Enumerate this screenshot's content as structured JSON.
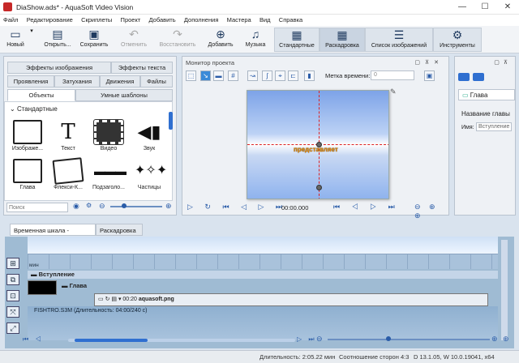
{
  "window": {
    "title": "DiaShow.ads* - AquaSoft Video Vision",
    "minimize": "—",
    "maximize": "☐",
    "close": "✕"
  },
  "menu": [
    "Файл",
    "Редактирование",
    "Скриплеты",
    "Проект",
    "Добавить",
    "Дополнения",
    "Мастера",
    "Вид",
    "Справка"
  ],
  "toolbar": {
    "new": "Новый",
    "open": "Открыть...",
    "save": "Сохранить",
    "undo": "Отменить",
    "redo": "Восстановить",
    "add": "Добавить",
    "music": "Музыка",
    "standard": "Стандартные",
    "storyboard": "Раскадровка",
    "image_list": "Список изображений",
    "tools": "Инструменты"
  },
  "left_panel": {
    "tabs_row1": [
      "Эффекты изображения",
      "Эффекты текста"
    ],
    "tabs_row2": [
      "Проявления",
      "Затухания",
      "Движения",
      "Файлы"
    ],
    "tabs_row3": [
      "Объекты",
      "Умные шаблоны"
    ],
    "section": "Стандартные",
    "objects": [
      {
        "label": "Изображе...",
        "icon": "image-icon"
      },
      {
        "label": "Текст",
        "icon": "text-icon"
      },
      {
        "label": "Видео",
        "icon": "video-icon"
      },
      {
        "label": "Звук",
        "icon": "sound-icon"
      },
      {
        "label": "Глава",
        "icon": "chapter-icon"
      },
      {
        "label": "Флекси-К...",
        "icon": "flexi-collage-icon"
      },
      {
        "label": "Подзаголо...",
        "icon": "subtitle-icon"
      },
      {
        "label": "Частицы",
        "icon": "particles-icon"
      }
    ],
    "search_placeholder": "Поиск"
  },
  "monitor": {
    "title": "Монитор проекта",
    "time_label": "Метка времени:",
    "time_value": "0",
    "preview_text": "представляет",
    "timecode": "00:00.000"
  },
  "right_panel": {
    "tab": "Глава",
    "heading": "Название главы",
    "name_label": "Имя:",
    "name_value": "Вступление"
  },
  "timeline": {
    "tabs": [
      "Временная шкала - дорожки",
      "Раскадровка"
    ],
    "ruler_label": "мин",
    "chapter_title": "Вступление",
    "group_label": "Глава",
    "clip_time": "00:20",
    "clip_file": "aquasoft.png",
    "audio_track": "FISHTRO.S3M (Длительность: 04:00/240 с)"
  },
  "status": {
    "duration": "Длительность: 2:05.22 мин",
    "aspect": "Соотношение сторон 4:3",
    "version": "D 13.1.05, W 10.0.19041, x64"
  },
  "colors": {
    "accent": "#3a8ad8",
    "brand_red": "#c62828",
    "guide_red": "#dd2222",
    "timeline_bg": "#9fbbd3"
  }
}
